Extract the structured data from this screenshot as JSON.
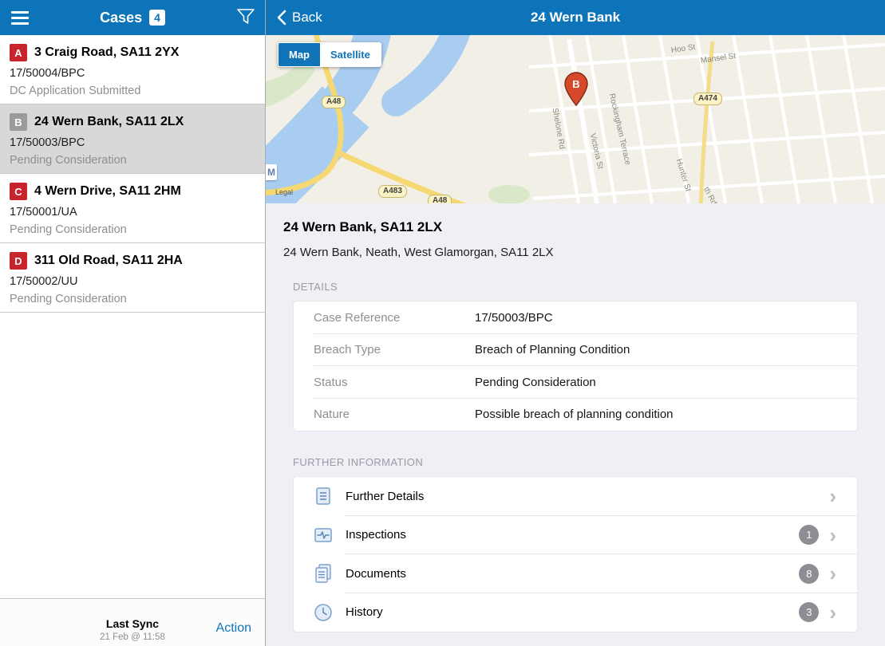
{
  "colors": {
    "header_blue": "#0e74ba",
    "accent_blue": "#1173b8",
    "case_badge_red": "#c8242c",
    "case_badge_gray": "#9b9b9b",
    "selected_row_gray": "#d8d8d8",
    "count_badge_gray": "#8d8d93",
    "marker_orange": "#d6492b"
  },
  "sidebar": {
    "title": "Cases",
    "count": "4",
    "cases": [
      {
        "letter": "A",
        "address": "3 Craig Road, SA11 2YX",
        "reference": "17/50004/BPC",
        "status": "DC Application Submitted",
        "selected": false
      },
      {
        "letter": "B",
        "address": "24 Wern Bank, SA11 2LX",
        "reference": "17/50003/BPC",
        "status": "Pending Consideration",
        "selected": true
      },
      {
        "letter": "C",
        "address": "4 Wern Drive, SA11 2HM",
        "reference": "17/50001/UA",
        "status": "Pending Consideration",
        "selected": false
      },
      {
        "letter": "D",
        "address": "311 Old Road, SA11 2HA",
        "reference": "17/50002/UU",
        "status": "Pending Consideration",
        "selected": false
      }
    ],
    "footer": {
      "last_sync_label": "Last Sync",
      "last_sync_value": "21 Feb @ 11:58",
      "action_label": "Action"
    }
  },
  "detail": {
    "back_label": "Back",
    "title": "24 Wern Bank",
    "map": {
      "map_button": "Map",
      "satellite_button": "Satellite",
      "marker_label": "B",
      "legal_label": "Legal",
      "logo_label": "M",
      "road_badges": [
        {
          "label": "A48"
        },
        {
          "label": "A483"
        },
        {
          "label": "A48"
        },
        {
          "label": "A474"
        }
      ],
      "streets": [
        {
          "name": "Hoo St"
        },
        {
          "name": "Mansel St"
        },
        {
          "name": "Rockingham Terrace"
        },
        {
          "name": "Victoria St"
        },
        {
          "name": "Hunter St"
        },
        {
          "name": "th Rd"
        },
        {
          "name": "Shelone Rd"
        }
      ]
    },
    "heading": "24 Wern Bank, SA11 2LX",
    "subheading": "24 Wern Bank, Neath, West Glamorgan, SA11 2LX",
    "details_section": {
      "title": "DETAILS",
      "rows": [
        {
          "label": "Case Reference",
          "value": "17/50003/BPC"
        },
        {
          "label": "Breach Type",
          "value": "Breach of Planning Condition"
        },
        {
          "label": "Status",
          "value": "Pending Consideration"
        },
        {
          "label": "Nature",
          "value": "Possible breach of planning condition"
        }
      ]
    },
    "further_section": {
      "title": "FURTHER INFORMATION",
      "items": [
        {
          "label": "Further Details",
          "badge": ""
        },
        {
          "label": "Inspections",
          "badge": "1"
        },
        {
          "label": "Documents",
          "badge": "8"
        },
        {
          "label": "History",
          "badge": "3"
        }
      ]
    }
  }
}
